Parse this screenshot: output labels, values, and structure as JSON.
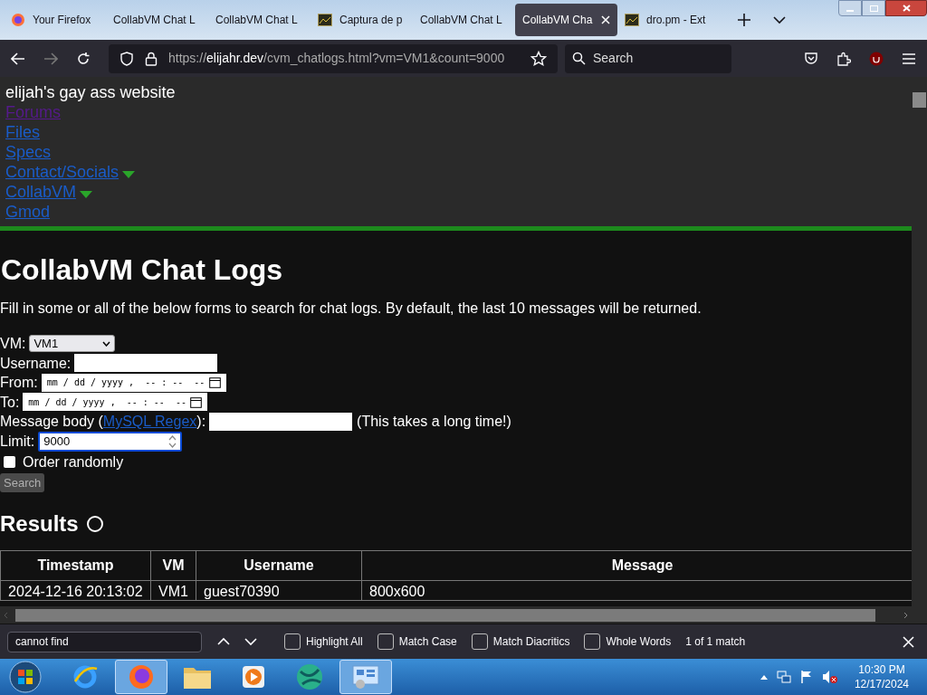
{
  "browser": {
    "tabs": [
      {
        "label": "Your Firefox",
        "kind": "firefox",
        "selected": false
      },
      {
        "label": "CollabVM Chat L",
        "kind": "plain",
        "selected": false
      },
      {
        "label": "CollabVM Chat L",
        "kind": "plain",
        "selected": false
      },
      {
        "label": "Captura de p",
        "kind": "image",
        "selected": false
      },
      {
        "label": "CollabVM Chat L",
        "kind": "plain",
        "selected": false
      },
      {
        "label": "CollabVM Cha",
        "kind": "plain",
        "selected": true
      },
      {
        "label": "dro.pm - Ext",
        "kind": "image",
        "selected": false
      }
    ],
    "url_prefix": "https://",
    "url_host": "elijahr.dev",
    "url_path": "/cvm_chatlogs.html?vm=VM1&count=9000",
    "search_placeholder": "Search"
  },
  "site": {
    "title": "elijah's gay ass website",
    "nav": [
      {
        "label": "Forums",
        "visited": true,
        "dropdown": false
      },
      {
        "label": "Files",
        "visited": false,
        "dropdown": false
      },
      {
        "label": "Specs",
        "visited": false,
        "dropdown": false
      },
      {
        "label": "Contact/Socials",
        "visited": false,
        "dropdown": true
      },
      {
        "label": "CollabVM",
        "visited": false,
        "dropdown": true
      },
      {
        "label": "Gmod",
        "visited": false,
        "dropdown": false
      }
    ]
  },
  "page": {
    "heading": "CollabVM Chat Logs",
    "intro": "Fill in some or all of the below forms to search for chat logs. By default, the last 10 messages will be returned.",
    "form": {
      "vm_label": "VM:",
      "vm_value": "VM1",
      "username_label": "Username:",
      "from_label": "From:",
      "from_placeholder": "mm / dd / yyyy ,  -- : --  --",
      "to_label": "To:",
      "to_placeholder": "mm / dd / yyyy ,  -- : --  --",
      "message_label_before": "Message body (",
      "message_link": "MySQL Regex",
      "message_label_after": "):",
      "message_note": "(This takes a long time!)",
      "limit_label": "Limit:",
      "limit_value": "9000",
      "limit_focused": true,
      "order_label": "Order randomly",
      "order_checked": false,
      "submit": "Search",
      "submit_disabled": true
    },
    "results_heading": "Results",
    "loading": true,
    "table": {
      "columns": [
        "Timestamp",
        "VM",
        "Username",
        "Message"
      ],
      "rows": [
        [
          "2024-12-16 20:13:02",
          "VM1",
          "guest70390",
          "800x600"
        ]
      ]
    }
  },
  "find_bar": {
    "value": "cannot find",
    "options": [
      {
        "label": "Highlight All",
        "checked": false
      },
      {
        "label": "Match Case",
        "checked": false
      },
      {
        "label": "Match Diacritics",
        "checked": false
      },
      {
        "label": "Whole Words",
        "checked": false
      }
    ],
    "status": "1 of 1 match"
  },
  "taskbar": {
    "apps": [
      {
        "kind": "ie",
        "selected": false
      },
      {
        "kind": "firefox",
        "selected": true
      },
      {
        "kind": "folder",
        "selected": false
      },
      {
        "kind": "media",
        "selected": false
      },
      {
        "kind": "globe",
        "selected": false
      },
      {
        "kind": "control",
        "selected": true
      }
    ],
    "time": "10:30 PM",
    "date": "12/17/2024"
  }
}
